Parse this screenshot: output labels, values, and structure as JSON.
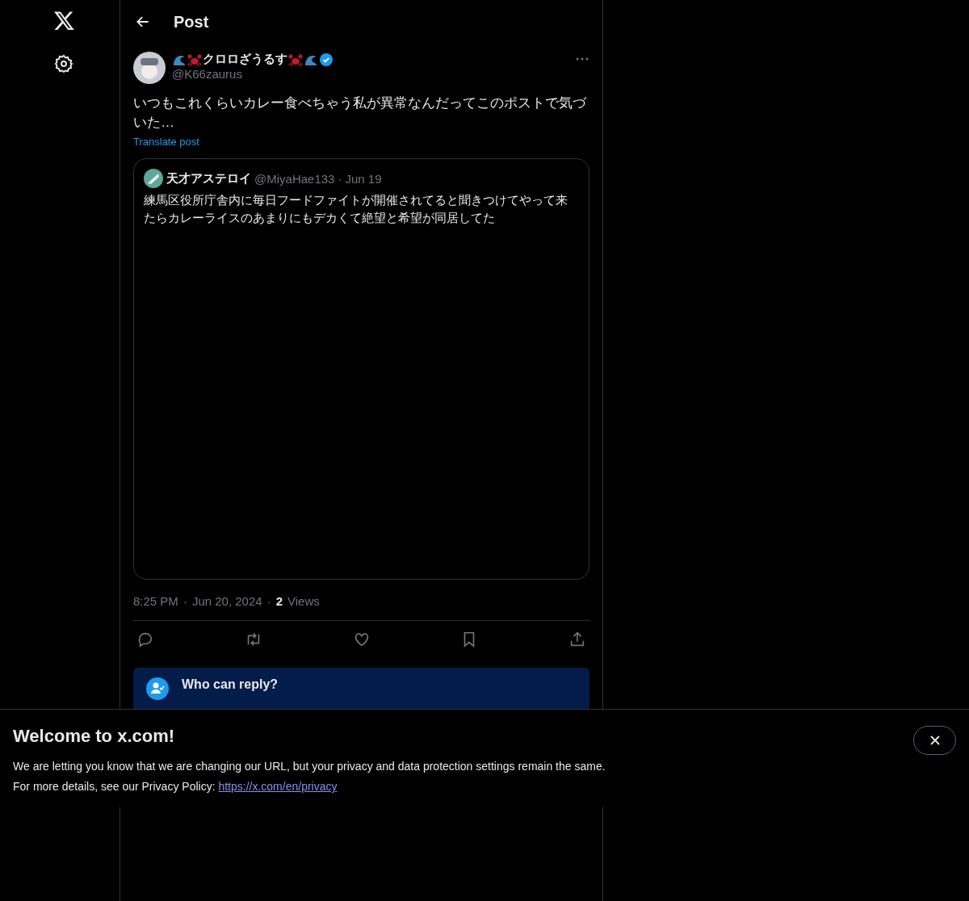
{
  "header": {
    "title": "Post"
  },
  "post": {
    "author": {
      "name": "クロロざうるす",
      "handle": "@K66zaurus",
      "verified": true
    },
    "text": "いつもこれくらいカレー食べちゃう私が異常なんだってこのポストで気づいた…",
    "translate": "Translate post",
    "quote": {
      "name": "天才アステロイ",
      "handle": "@MiyaHae133",
      "separator": "·",
      "date": "Jun 19",
      "text": "練馬区役所庁舎内に毎日フードファイトが開催されてると聞きつけてやって来たらカレーライスのあまりにもデカくて絶望と希望が同居してた"
    },
    "meta": {
      "time": "8:25 PM",
      "sep1": "·",
      "date": "Jun 20, 2024",
      "sep2": "·",
      "views_count": "2",
      "views_label": "Views"
    },
    "reply_notice": {
      "title": "Who can reply?"
    }
  },
  "banner": {
    "title": "Welcome to x.com!",
    "line1": "We are letting you know that we are changing our URL, but your privacy and data protection settings remain the same.",
    "line2": "For more details, see our Privacy Policy:",
    "link": "https://x.com/en/privacy"
  }
}
